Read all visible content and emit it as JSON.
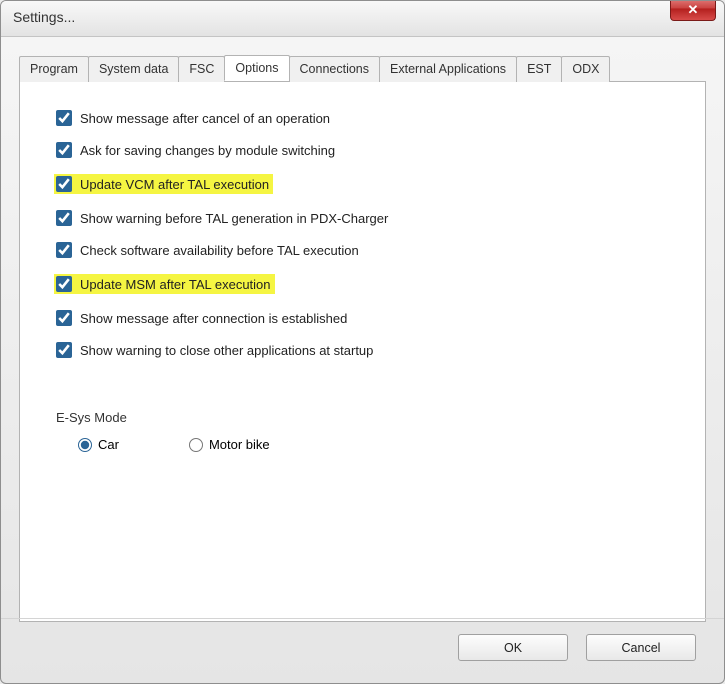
{
  "window": {
    "title": "Settings..."
  },
  "tabs": {
    "program": "Program",
    "system_data": "System data",
    "fsc": "FSC",
    "options": "Options",
    "connections": "Connections",
    "ext_apps": "External Applications",
    "est": "EST",
    "odx": "ODX",
    "active": "options"
  },
  "options": {
    "chk_cancel": {
      "label": "Show message after cancel of an operation",
      "checked": true,
      "highlight": false
    },
    "chk_save": {
      "label": "Ask for saving changes by module switching",
      "checked": true,
      "highlight": false
    },
    "chk_vcm": {
      "label": "Update VCM after TAL execution",
      "checked": true,
      "highlight": true
    },
    "chk_warn_tal": {
      "label": "Show warning before TAL generation in PDX-Charger",
      "checked": true,
      "highlight": false
    },
    "chk_sw_avail": {
      "label": "Check software availability before TAL execution",
      "checked": true,
      "highlight": false
    },
    "chk_msm": {
      "label": "Update MSM after TAL execution",
      "checked": true,
      "highlight": true
    },
    "chk_conn": {
      "label": "Show message after connection is established",
      "checked": true,
      "highlight": false
    },
    "chk_startup": {
      "label": "Show warning to close other applications at startup",
      "checked": true,
      "highlight": false
    }
  },
  "mode": {
    "title": "E-Sys Mode",
    "car": "Car",
    "motorbike": "Motor bike",
    "selected": "car"
  },
  "buttons": {
    "ok": "OK",
    "cancel": "Cancel"
  }
}
